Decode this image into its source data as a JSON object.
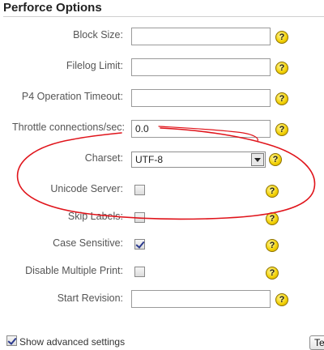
{
  "section": {
    "title": "Perforce Options"
  },
  "help_icon_glyph": "?",
  "rows": {
    "block_size": {
      "label": "Block Size:",
      "value": ""
    },
    "filelog_limit": {
      "label": "Filelog Limit:",
      "value": ""
    },
    "p4_timeout": {
      "label": "P4 Operation Timeout:",
      "value": ""
    },
    "throttle": {
      "label": "Throttle connections/sec:",
      "value": "0.0"
    },
    "charset": {
      "label": "Charset:",
      "selected": "UTF-8"
    },
    "unicode_server": {
      "label": "Unicode Server:",
      "checked": false
    },
    "skip_labels": {
      "label": "Skip Labels:",
      "checked": false
    },
    "case_sensitive": {
      "label": "Case Sensitive:",
      "checked": true
    },
    "disable_multiple_print": {
      "label": "Disable Multiple Print:",
      "checked": false
    },
    "start_revision": {
      "label": "Start Revision:",
      "value": ""
    }
  },
  "footer": {
    "advanced_label": "Show advanced settings",
    "advanced_checked": true,
    "button_label": "Te"
  },
  "annotation": {
    "color": "#e0141b",
    "shape": "hand-drawn ellipse around Charset and Unicode Server"
  }
}
